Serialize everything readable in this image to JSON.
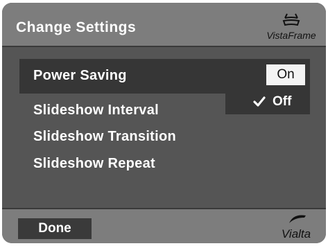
{
  "header": {
    "title": "Change Settings",
    "brand": {
      "icon": "vistaframe-logo-icon",
      "name": "VistaFrame"
    }
  },
  "menu": {
    "items": [
      {
        "label": "Power Saving",
        "selected": true
      },
      {
        "label": "Slideshow Interval",
        "selected": false
      },
      {
        "label": "Slideshow Transition",
        "selected": false
      },
      {
        "label": "Slideshow Repeat",
        "selected": false
      }
    ]
  },
  "options": {
    "on": {
      "label": "On",
      "highlighted": true
    },
    "off": {
      "label": "Off",
      "checked": true,
      "check_icon": "checkmark-icon"
    }
  },
  "footer": {
    "done_label": "Done",
    "logo": {
      "icon": "vialta-logo-icon",
      "name": "Vialta"
    }
  },
  "colors": {
    "header_bg": "#7d7d7d",
    "body_bg": "#555555",
    "selected_bg": "#363636",
    "highlight_bg": "#f4f4f4",
    "text": "#ffffff"
  }
}
